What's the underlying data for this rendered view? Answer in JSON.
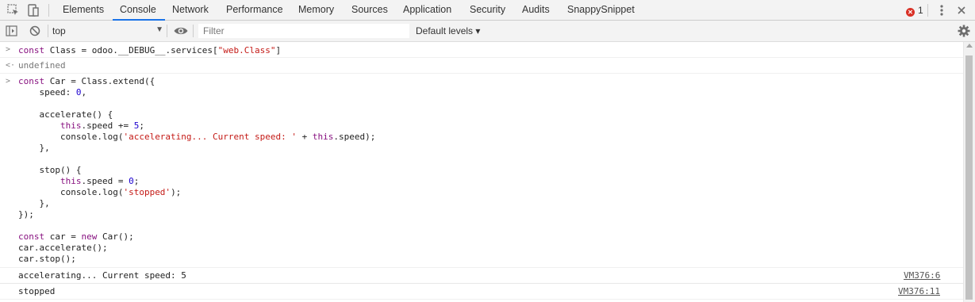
{
  "devtools": {
    "tabs": [
      "Elements",
      "Console",
      "Network",
      "Performance",
      "Memory",
      "Sources",
      "Application",
      "Security",
      "Audits",
      "SnappySnippet"
    ],
    "active_tab": "Console",
    "error_count": "1"
  },
  "toolbar": {
    "context": "top",
    "filter_placeholder": "Filter",
    "levels_label": "Default levels ▾"
  },
  "console": {
    "entry1_input": "const Class = odoo.__DEBUG__.services[\"web.Class\"]",
    "entry1_result": "undefined",
    "log1_text": "accelerating... Current speed: 5",
    "log1_source": "VM376:6",
    "log2_text": "stopped",
    "log2_source": "VM376:11"
  },
  "colors": {
    "active_tab_underline": "#1a73e8",
    "error_badge": "#d93025"
  },
  "icons": [
    "inspect-element-icon",
    "device-toolbar-icon",
    "kebab-menu-icon",
    "close-icon",
    "sidebar-toggle-icon",
    "clear-console-icon",
    "eye-icon",
    "settings-gear-icon"
  ]
}
